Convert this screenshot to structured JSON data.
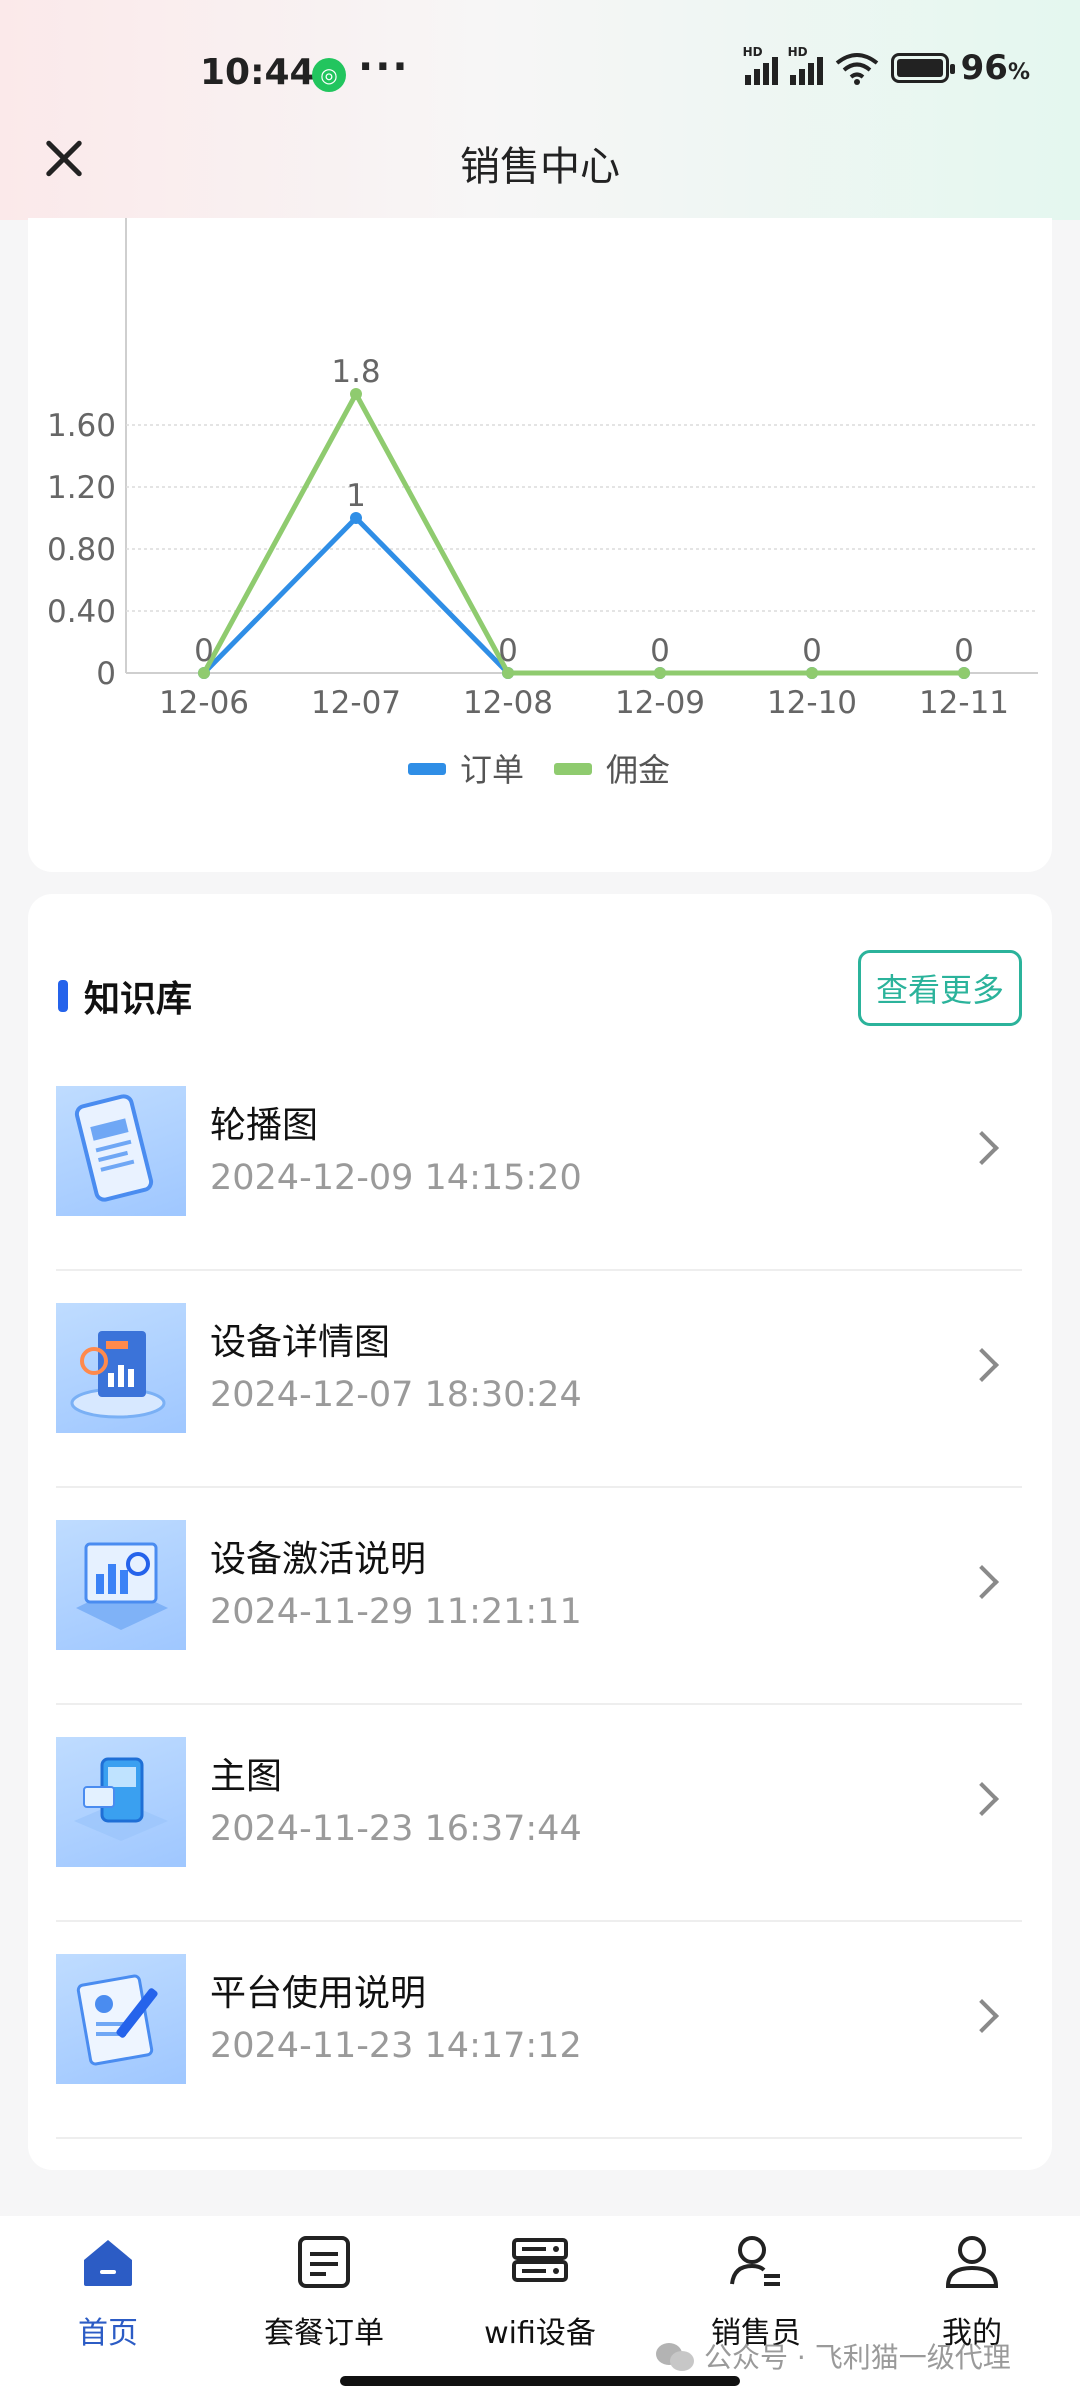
{
  "status_bar": {
    "time": "10:44",
    "more": "···",
    "battery_percent": "96",
    "battery_unit": "%",
    "signal_labels": [
      "HD",
      "HD"
    ]
  },
  "nav": {
    "title": "销售中心"
  },
  "chart_data": {
    "type": "line",
    "categories": [
      "12-06",
      "12-07",
      "12-08",
      "12-09",
      "12-10",
      "12-11"
    ],
    "series": [
      {
        "name": "订单",
        "color": "#2f8ee6",
        "values": [
          0,
          1,
          0,
          0,
          0,
          0
        ]
      },
      {
        "name": "佣金",
        "color": "#8fcb6f",
        "values": [
          0,
          1.8,
          0,
          0,
          0,
          0
        ]
      }
    ],
    "data_labels": {
      "订单": [
        "0",
        "1",
        "",
        "",
        "",
        ""
      ],
      "佣金": [
        "",
        "1.8",
        "0",
        "0",
        "0",
        "0"
      ]
    },
    "y_ticks": [
      "0",
      "0.40",
      "0.80",
      "1.20",
      "1.60"
    ],
    "y_tick_values": [
      0,
      0.4,
      0.8,
      1.2,
      1.6
    ],
    "ylim": [
      0,
      1.8
    ],
    "grid": true,
    "legend": "bottom-center"
  },
  "knowledge": {
    "title": "知识库",
    "more_label": "查看更多",
    "items": [
      {
        "name": "轮播图",
        "date": "2024-12-09 14:15:20"
      },
      {
        "name": "设备详情图",
        "date": "2024-12-07 18:30:24"
      },
      {
        "name": "设备激活说明",
        "date": "2024-11-29 11:21:11"
      },
      {
        "name": "主图",
        "date": "2024-11-23 16:37:44"
      },
      {
        "name": "平台使用说明",
        "date": "2024-11-23 14:17:12"
      }
    ]
  },
  "tabs": [
    {
      "label": "首页",
      "icon": "home-icon",
      "active": true
    },
    {
      "label": "套餐订单",
      "icon": "order-list-icon",
      "active": false
    },
    {
      "label": "wifi设备",
      "icon": "wifi-device-icon",
      "active": false
    },
    {
      "label": "销售员",
      "icon": "salesperson-icon",
      "active": false
    },
    {
      "label": "我的",
      "icon": "profile-icon",
      "active": false
    }
  ],
  "watermark": "公众号 · 飞利猫一级代理",
  "colors": {
    "accent": "#2563eb",
    "tab_active": "#2c5cc5",
    "more_button": "#2bb39b"
  }
}
